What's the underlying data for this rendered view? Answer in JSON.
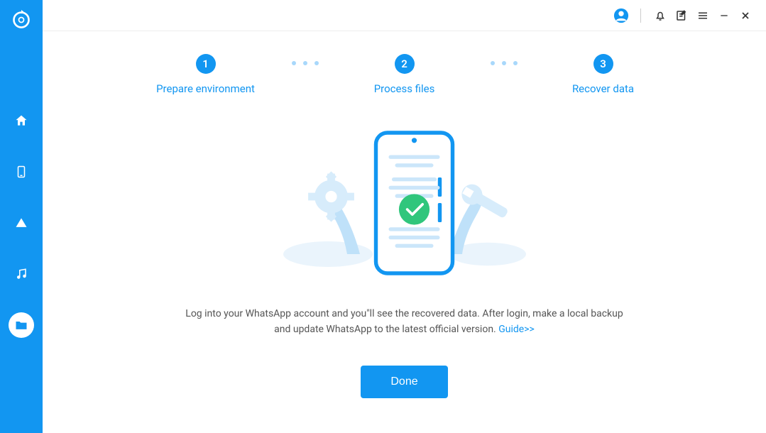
{
  "steps": [
    {
      "num": "1",
      "label": "Prepare environment"
    },
    {
      "num": "2",
      "label": "Process files"
    },
    {
      "num": "3",
      "label": "Recover data"
    }
  ],
  "instruction": {
    "text1": "Log into your WhatsApp account and you\"ll see the recovered data. After login, make a local backup and update WhatsApp to the latest official version. ",
    "guide_label": "Guide>>"
  },
  "buttons": {
    "done": "Done"
  }
}
